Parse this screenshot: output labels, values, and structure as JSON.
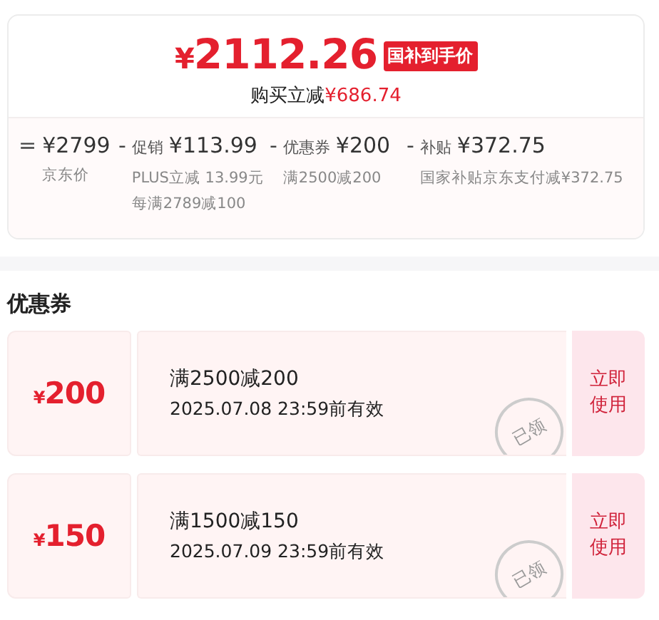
{
  "price": {
    "symbol": "¥",
    "amount": "2112.26",
    "badge": "国补到手价"
  },
  "saving": {
    "label": "购买立减",
    "amount": "¥686.74"
  },
  "breakdown": [
    {
      "operator": "=",
      "amount": "¥2799",
      "notes": [
        "京东价"
      ]
    },
    {
      "operator": "-",
      "label": "促销",
      "amount": "¥113.99",
      "notes": [
        "PLUS立减 13.99元",
        "每满2789减100"
      ]
    },
    {
      "operator": "-",
      "label": "优惠券",
      "amount": "¥200",
      "notes": [
        "满2500减200"
      ]
    },
    {
      "operator": "-",
      "label": "补贴",
      "amount": "¥372.75",
      "notes": [
        "国家补贴京东支付减¥372.75"
      ]
    }
  ],
  "coupons_section": {
    "title": "优惠券",
    "coupons": [
      {
        "symbol": "¥",
        "amount": "200",
        "condition": "满2500减200",
        "validity": "2025.07.08 23:59前有效",
        "action": "立即使用",
        "stamp": "已领"
      },
      {
        "symbol": "¥",
        "amount": "150",
        "condition": "满1500减150",
        "validity": "2025.07.09 23:59前有效",
        "action": "立即使用",
        "stamp": "已领"
      }
    ]
  }
}
